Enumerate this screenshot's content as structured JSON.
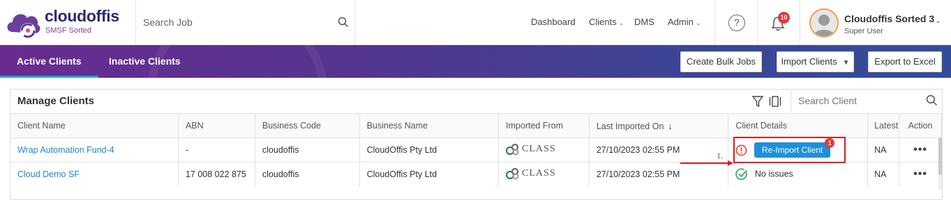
{
  "app": {
    "brand": "cloudoffis",
    "sub_brand": "SMSF Sorted"
  },
  "search_job": {
    "placeholder": "Search Job"
  },
  "top_nav": [
    {
      "label": "Dashboard"
    },
    {
      "label": "Clients"
    },
    {
      "label": "DMS"
    },
    {
      "label": "Admin"
    }
  ],
  "notifications": {
    "count": "10"
  },
  "user": {
    "name": "Cloudoffis Sorted 3",
    "role": "Super User"
  },
  "tabs": [
    {
      "label": "Active Clients",
      "active": true
    },
    {
      "label": "Inactive Clients",
      "active": false
    }
  ],
  "actions": {
    "create_bulk_jobs": "Create Bulk Jobs",
    "import_clients": "Import Clients",
    "export_excel": "Export to Excel"
  },
  "panel": {
    "title": "Manage Clients",
    "search_placeholder": "Search Client"
  },
  "table": {
    "columns": [
      "Client Name",
      "ABN",
      "Business Code",
      "Business Name",
      "Imported From",
      "Last Imported On",
      "Client Details",
      "Latest",
      "Action"
    ],
    "rows": [
      {
        "client_name": "Wrap Automation Fund-4",
        "abn": "-",
        "business_code": "cloudoffis",
        "business_name": "CloudOffis Pty Ltd",
        "imported_from": "CLASS",
        "last_imported": "27/10/2023 02:55 PM",
        "details_button": "Re-Import Client",
        "details_badge": "1",
        "latest": "NA",
        "action": "•••"
      },
      {
        "client_name": "Cloud Demo SF",
        "abn": "17 008 022 875",
        "business_code": "cloudoffis",
        "business_name": "CloudOffis Pty Ltd",
        "imported_from": "CLASS",
        "last_imported": "27/10/2023 02:55 PM",
        "details_text": "No issues",
        "latest": "NA",
        "action": "•••"
      }
    ]
  },
  "annotation": {
    "step": "1."
  },
  "colors": {
    "accent": "#1e90d8",
    "brand": "#2b2a6e",
    "alert": "#e53935",
    "success": "#3aa35c"
  }
}
